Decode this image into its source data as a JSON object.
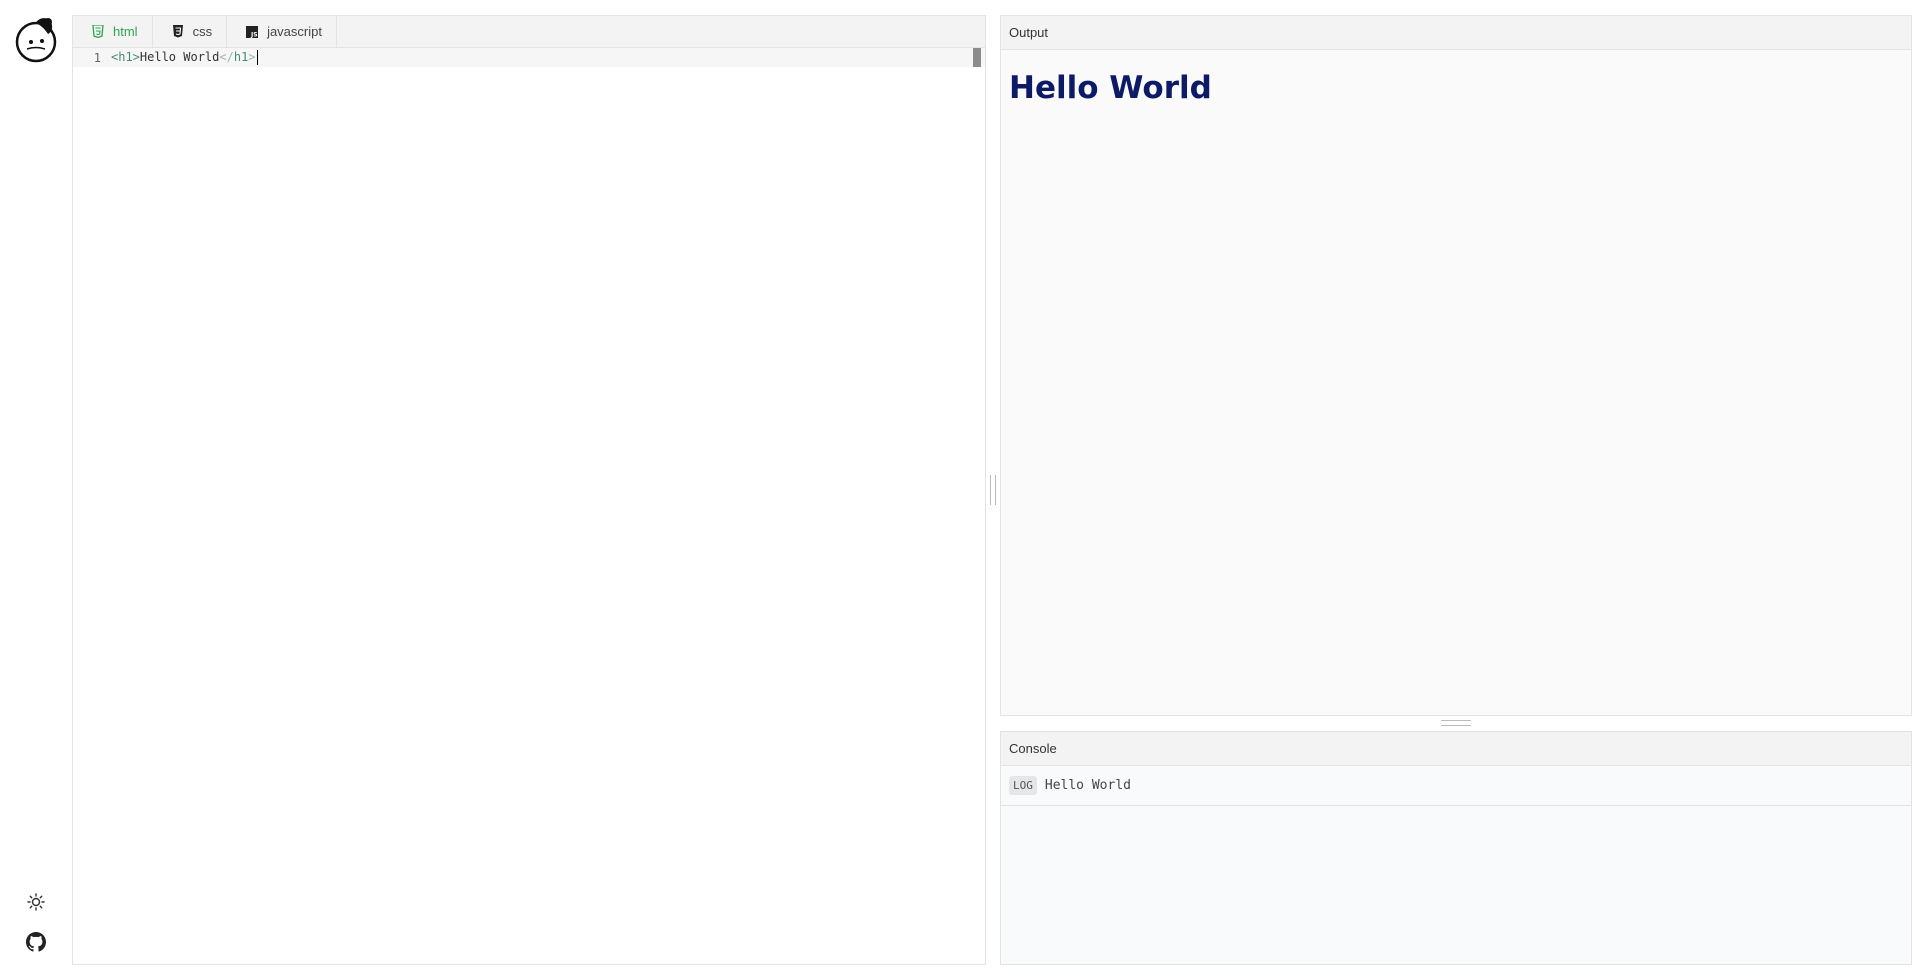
{
  "sidebar": {
    "logo_icon": "mascot-face-icon",
    "theme_icon": "sun-icon",
    "github_icon": "github-icon"
  },
  "editor": {
    "tabs": [
      {
        "label": "html",
        "icon": "html5-icon",
        "active": true
      },
      {
        "label": "css",
        "icon": "css3-icon",
        "active": false
      },
      {
        "label": "javascript",
        "icon": "js-icon",
        "active": false
      }
    ],
    "line_number": "1",
    "code": {
      "open_tag": "<h1>",
      "text": "Hello World",
      "close_tag_lt": "</",
      "close_tag_name": "h1",
      "close_tag_gt": ">"
    }
  },
  "output": {
    "title": "Output",
    "heading": "Hello World",
    "heading_color": "#0d1a66"
  },
  "console": {
    "title": "Console",
    "entries": [
      {
        "level": "LOG",
        "message": "Hello World"
      }
    ]
  },
  "colors": {
    "active_tab": "#2ea44f"
  }
}
